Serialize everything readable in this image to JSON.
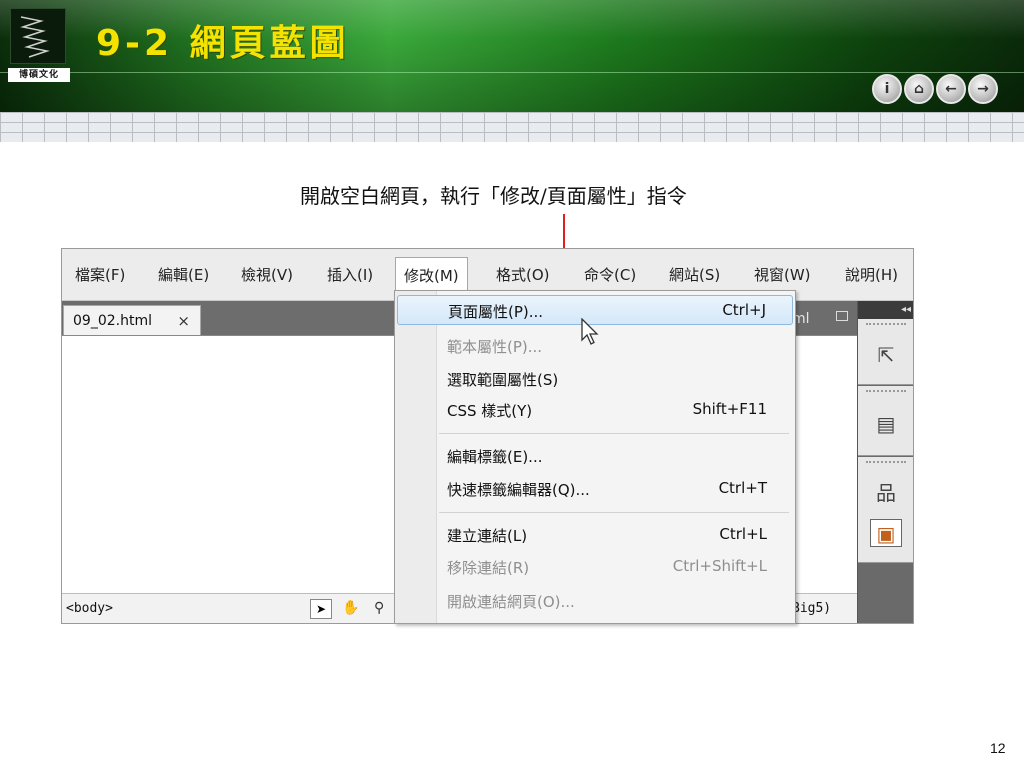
{
  "slide": {
    "title": "9-2  網頁藍圖",
    "logo_text": "博碩文化",
    "instruction": "開啟空白網頁，執行「修改/頁面屬性」指令",
    "page_number": "12",
    "nav_icons": [
      "info-icon",
      "home-icon",
      "back-icon",
      "forward-icon"
    ]
  },
  "app": {
    "menu": [
      "檔案(F)",
      "編輯(E)",
      "檢視(V)",
      "插入(I)",
      "修改(M)",
      "格式(O)",
      "命令(C)",
      "網站(S)",
      "視窗(W)",
      "說明(H)"
    ],
    "active_menu_index": 4,
    "doc_tab": "09_02.html",
    "tab_close": "×",
    "tab_right_text": "ml",
    "status_tag": "<body>",
    "encoding": "Big5)",
    "side_collapse": "◂◂"
  },
  "dropdown": {
    "items": [
      {
        "label": "頁面屬性(P)...",
        "shortcut": "Ctrl+J",
        "state": "hover"
      },
      {
        "label": "範本屬性(P)...",
        "shortcut": "",
        "state": "disabled"
      },
      {
        "label": "選取範圍屬性(S)",
        "shortcut": "",
        "state": "normal"
      },
      {
        "label": "CSS 樣式(Y)",
        "shortcut": "Shift+F11",
        "state": "normal"
      },
      {
        "label": "編輯標籤(E)...",
        "shortcut": "",
        "state": "normal"
      },
      {
        "label": "快速標籤編輯器(Q)...",
        "shortcut": "Ctrl+T",
        "state": "normal"
      },
      {
        "label": "建立連結(L)",
        "shortcut": "Ctrl+L",
        "state": "normal"
      },
      {
        "label": "移除連結(R)",
        "shortcut": "Ctrl+Shift+L",
        "state": "disabled"
      },
      {
        "label": "開啟連結網頁(O)...",
        "shortcut": "",
        "state": "disabled"
      }
    ]
  },
  "colors": {
    "title": "#f4e200",
    "arrow": "#e02020",
    "hover": "#d4e8f9"
  }
}
